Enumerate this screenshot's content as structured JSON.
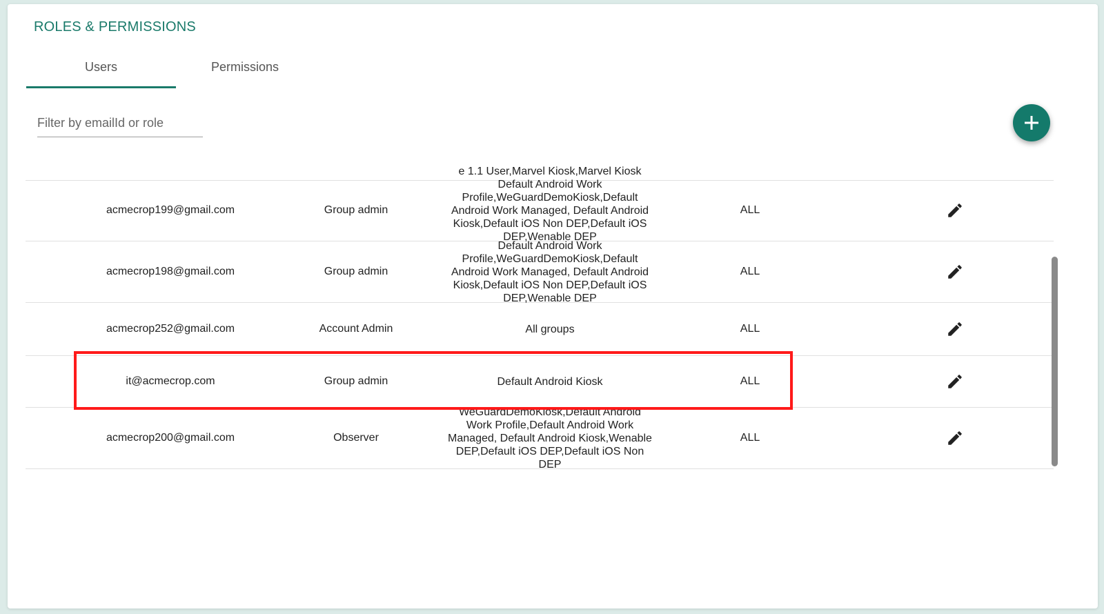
{
  "title": "ROLES & PERMISSIONS",
  "tabs": [
    {
      "label": "Users",
      "active": true
    },
    {
      "label": "Permissions",
      "active": false
    }
  ],
  "filter": {
    "placeholder": "Filter by emailId or role",
    "value": ""
  },
  "accent_color": "#1a7a6a",
  "highlight_color": "#ff1a1a",
  "rows": [
    {
      "email": "",
      "role": "",
      "groups": "e 1.1 User,Marvel Kiosk,Marvel Kiosk",
      "access": ""
    },
    {
      "email": "acmecrop199@gmail.com",
      "role": "Group admin",
      "groups": "Default Android Work Profile,WeGuardDemoKiosk,Default Android Work Managed, Default Android Kiosk,Default iOS Non DEP,Default iOS DEP,Wenable DEP",
      "access": "ALL"
    },
    {
      "email": "acmecrop198@gmail.com",
      "role": "Group admin",
      "groups": "Default Android Work Profile,WeGuardDemoKiosk,Default Android Work Managed, Default Android Kiosk,Default iOS Non DEP,Default iOS DEP,Wenable DEP",
      "access": "ALL"
    },
    {
      "email": "acmecrop252@gmail.com",
      "role": "Account Admin",
      "groups": "All groups",
      "access": "ALL"
    },
    {
      "email": "it@acmecrop.com",
      "role": "Group admin",
      "groups": "Default Android Kiosk",
      "access": "ALL"
    },
    {
      "email": "acmecrop200@gmail.com",
      "role": "Observer",
      "groups": "WeGuardDemoKiosk,Default Android Work Profile,Default Android Work Managed, Default Android Kiosk,Wenable DEP,Default iOS DEP,Default iOS Non DEP",
      "access": "ALL"
    }
  ]
}
